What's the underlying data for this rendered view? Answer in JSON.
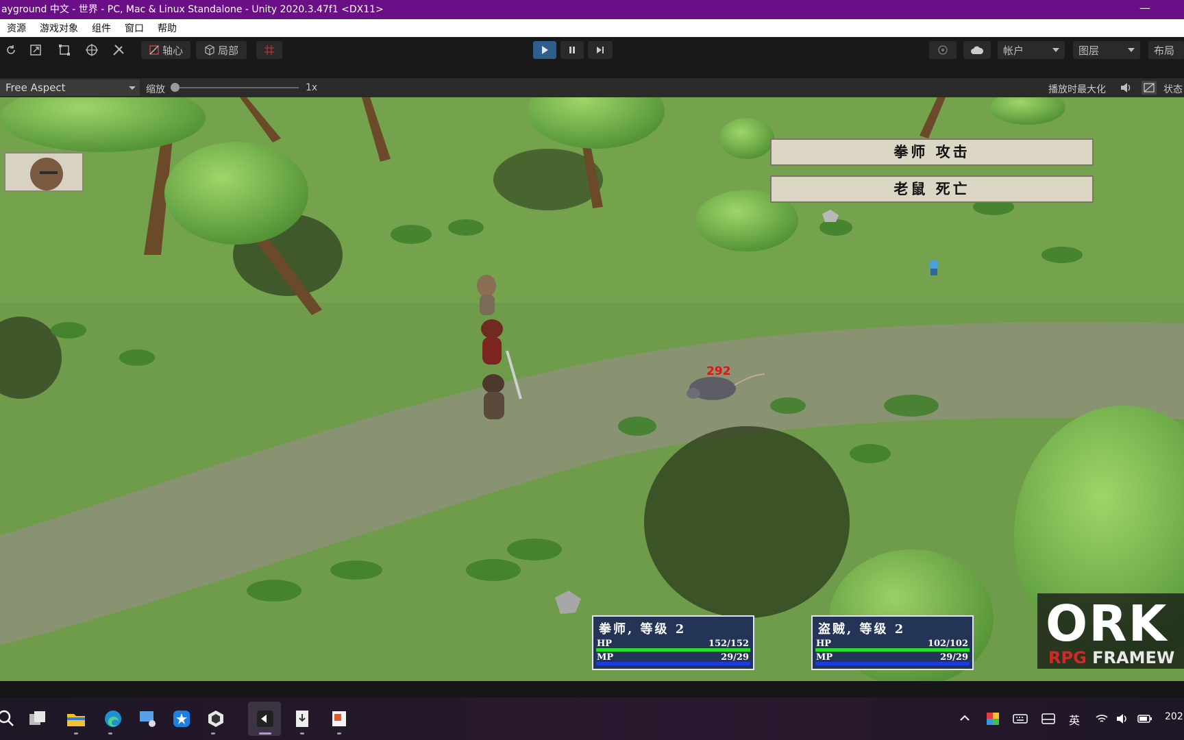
{
  "window": {
    "title": "ayground 中文 - 世界 - PC, Mac & Linux Standalone - Unity 2020.3.47f1 <DX11>",
    "minimize": "—"
  },
  "menu": [
    "资源",
    "游戏对象",
    "组件",
    "窗口",
    "帮助"
  ],
  "toolbar": {
    "pivot": "轴心",
    "local": "局部",
    "account": "帐户",
    "layers": "图层",
    "layout": "布局",
    "icons": [
      "rotate-tool-icon",
      "scale-tool-icon",
      "rect-tool-icon",
      "transform-tool-icon",
      "custom-tool-icon",
      "play-icon",
      "pause-icon",
      "step-icon",
      "collab-icon",
      "cloud-icon"
    ]
  },
  "game_view": {
    "aspect": "Free Aspect",
    "zoom_label": "缩放",
    "zoom_value": "1x",
    "zoom_level": 0,
    "maximize": "播放时最大化",
    "stats": "状态"
  },
  "game": {
    "messages": [
      "拳师 攻击",
      "老鼠 死亡"
    ],
    "damage": "292",
    "party": [
      {
        "name": "拳师, 等级 2",
        "hp_label": "HP",
        "hp": "152/152",
        "hp_frac": 1.0,
        "mp_label": "MP",
        "mp": "29/29",
        "mp_frac": 1.0
      },
      {
        "name": "盗贼, 等级 2",
        "hp_label": "HP",
        "hp": "102/102",
        "hp_frac": 1.0,
        "mp_label": "MP",
        "mp": "29/29",
        "mp_frac": 1.0
      }
    ],
    "logo": {
      "main": "ORK",
      "sub_red": "RPG",
      "sub_white": "FRAMEW"
    }
  },
  "taskbar": {
    "apps": [
      "search-icon",
      "task-view-icon",
      "file-explorer-icon",
      "edge-icon",
      "remote-desktop-icon",
      "app-store-icon",
      "unity-hub-icon",
      "unity-editor-icon",
      "installer-icon",
      "office-icon"
    ],
    "ime": "英",
    "clock": "202"
  }
}
